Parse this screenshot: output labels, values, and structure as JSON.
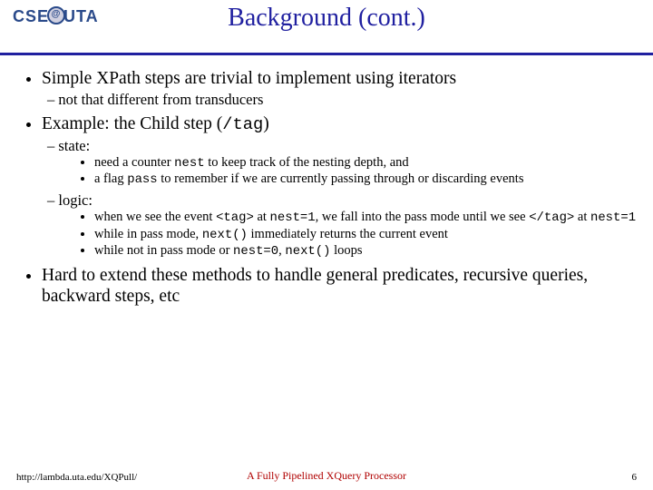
{
  "header": {
    "logo_left": "CSE",
    "logo_right": "UTA",
    "title": "Background (cont.)"
  },
  "bullets": {
    "b1_1": "Simple XPath steps are trivial to implement using iterators",
    "b1_1_s1": "not that different from transducers",
    "b1_2_a": "Example: the Child step (",
    "b1_2_code": "/tag",
    "b1_2_b": ")",
    "b1_2_s1": "state:",
    "b1_2_s1_i1_a": "need a counter ",
    "b1_2_s1_i1_code": "nest",
    "b1_2_s1_i1_b": " to keep track of the nesting depth, and",
    "b1_2_s1_i2_a": "a flag ",
    "b1_2_s1_i2_code": "pass",
    "b1_2_s1_i2_b": " to remember if we are currently passing through or discarding events",
    "b1_2_s2": "logic:",
    "b1_2_s2_i1_a": "when we see the event ",
    "b1_2_s2_i1_code1": "<tag>",
    "b1_2_s2_i1_b": " at ",
    "b1_2_s2_i1_code2": "nest=1",
    "b1_2_s2_i1_c": ", we fall into the pass mode until we see ",
    "b1_2_s2_i1_code3": "</tag>",
    "b1_2_s2_i1_d": " at ",
    "b1_2_s2_i1_code4": "nest=1",
    "b1_2_s2_i2_a": "while in pass mode, ",
    "b1_2_s2_i2_code": "next()",
    "b1_2_s2_i2_b": " immediately returns the current event",
    "b1_2_s2_i3_a": "while not in pass mode or ",
    "b1_2_s2_i3_code1": "nest=0",
    "b1_2_s2_i3_b": ", ",
    "b1_2_s2_i3_code2": "next()",
    "b1_2_s2_i3_c": " loops",
    "b1_3": "Hard to extend these methods to handle general predicates, recursive queries, backward steps, etc"
  },
  "footer": {
    "url": "http://lambda.uta.edu/XQPull/",
    "center": "A Fully Pipelined XQuery Processor",
    "page": "6"
  }
}
